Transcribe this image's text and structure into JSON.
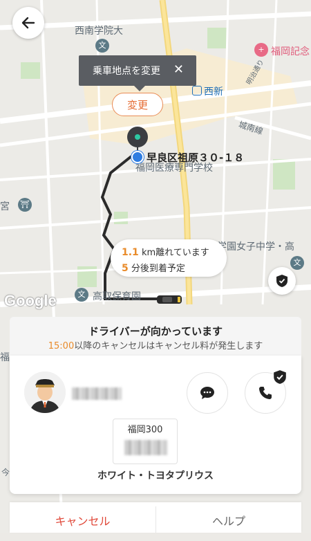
{
  "map": {
    "labels": {
      "school_west": "西南学院大",
      "fukuoka_kinen": "福岡記念",
      "nishijin_station": "西新",
      "meiji_dori": "明治通り",
      "joso_line": "城南線",
      "medical_school": "福岡医療専門学校",
      "girls_school": "学園女子中学・高",
      "hodo_nursery": "高取保育園",
      "shrine": "宮",
      "left_fuku": "福",
      "left_road": "今"
    },
    "google": "Google"
  },
  "back_button": {
    "icon": "arrow-left-icon"
  },
  "tooltip": {
    "text": "乗車地点を変更"
  },
  "change_button": {
    "label": "変更"
  },
  "pickup": {
    "address": "早良区祖原３０-１８"
  },
  "eta": {
    "distance_value": "1.1",
    "distance_text": " km離れています",
    "minutes_value": "5",
    "minutes_text": " 分後到着予定"
  },
  "status": {
    "title": "ドライバーが向かっています",
    "cancel_time": "15:00",
    "cancel_note": "以降のキャンセルはキャンセル料が発生します"
  },
  "plate": {
    "region": "福岡300"
  },
  "vehicle": {
    "description": "ホワイト・トヨタプリウス"
  },
  "actions": {
    "cancel": "キャンセル",
    "help": "ヘルプ"
  },
  "colors": {
    "accent": "#e98b2a",
    "cancel": "#e0493a",
    "route": "#2b2b2b",
    "pin_dot": "#2ec8a2"
  }
}
